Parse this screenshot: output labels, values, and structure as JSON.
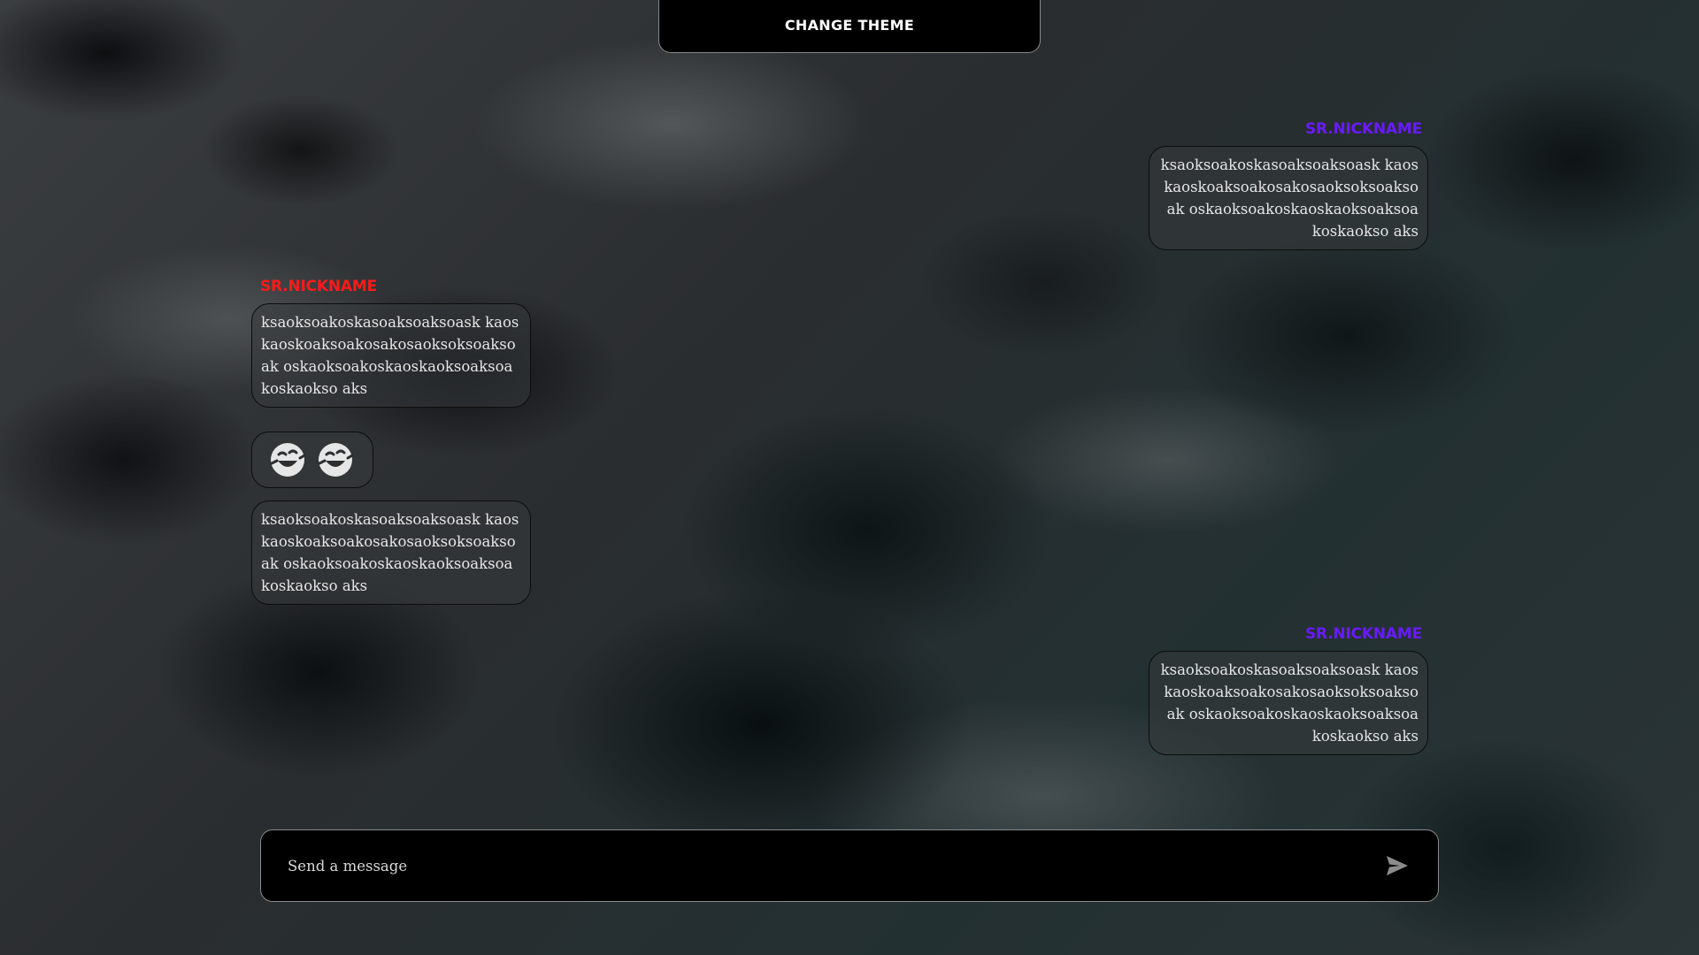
{
  "header": {
    "change_theme_label": "CHANGE THEME"
  },
  "messages": [
    {
      "side": "right",
      "nickname": "SR.NICKNAME",
      "nickname_color": "#6a1aff",
      "text": "ksaoksoakoskasoaksoaksoask kaoskaoskoaksoakosakosaoksoksoaksoak oskaoksoakoskaoskaoksoaksoakoskaokso aks"
    },
    {
      "side": "left",
      "nickname": "SR.NICKNAME",
      "nickname_color": "#ff1a1a",
      "text": "ksaoksoakoskasoaksoaksoask kaoskaoskoaksoakosakosaoksoksoaksoak oskaoksoakoskaoskaoksoaksoakoskaokso aks"
    },
    {
      "side": "left",
      "type": "emoji",
      "emojis": [
        "laughing-emoji",
        "laughing-emoji"
      ]
    },
    {
      "side": "left",
      "text": "ksaoksoakoskasoaksoaksoask kaoskaoskoaksoakosakosaoksoksoaksoak oskaoksoakoskaoskaoksoaksoakoskaokso aks"
    },
    {
      "side": "right",
      "nickname": "SR.NICKNAME",
      "nickname_color": "#6a1aff",
      "text": "ksaoksoakoskasoaksoaksoask kaoskaoskoaksoakosakosaoksoksoaksoak oskaoksoakoskaoskaoksoaksoakoskaokso aks"
    }
  ],
  "composer": {
    "placeholder": "Send a message",
    "value": "",
    "send_icon": "send-icon"
  },
  "colors": {
    "left_nickname": "#ff1a1a",
    "right_nickname": "#6a1aff",
    "bar_background": "#000000"
  }
}
